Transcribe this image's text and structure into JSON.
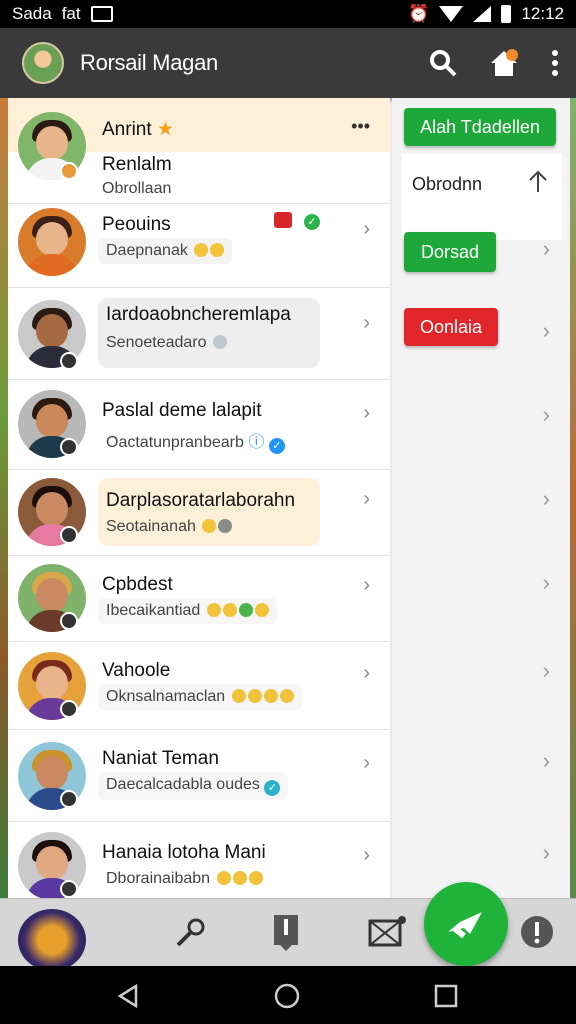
{
  "status": {
    "left1": "Sada",
    "left2": "fat",
    "time": "12:12"
  },
  "appbar": {
    "title": "Rorsail Magan"
  },
  "header_row": {
    "title": "Anrint",
    "name": "Renlalm",
    "sub": "Obrollaan"
  },
  "rows": [
    {
      "name": "Peouins",
      "sub": "Daepnanak"
    },
    {
      "name": "Iardoaobncheremlapa",
      "sub": "Senoeteadaro"
    },
    {
      "name": "Paslal deme lalapit",
      "sub": "Oactatunpranbearb"
    },
    {
      "name": "Darplasoratarlaborahn",
      "sub": "Seotainanah"
    },
    {
      "name": "Cpbdest",
      "sub": "Ibecaikantiad"
    },
    {
      "name": "Vahoole",
      "sub": "Oknsalnamaclan"
    },
    {
      "name": "Naniat Teman",
      "sub": "Daecalcadabla oudes"
    },
    {
      "name": "Hanaia lotoha Mani",
      "sub": "Dborainaibabn"
    }
  ],
  "right": {
    "top_button": "Alah Tdadellen",
    "item": "Obrodnn",
    "green_button": "Dorsad",
    "red_button": "Oonlaia"
  },
  "colors": {
    "green": "#1fa83a",
    "red": "#e0262a",
    "appbar": "#3a3a3a"
  }
}
